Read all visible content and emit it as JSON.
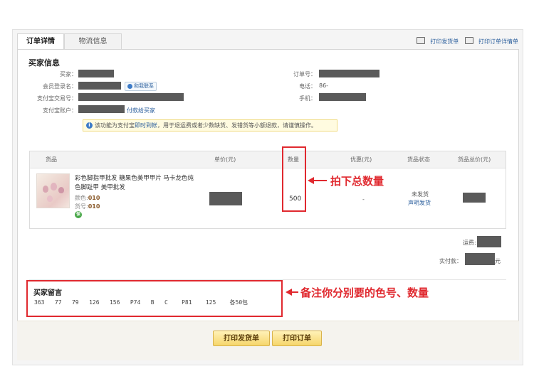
{
  "tabs": [
    {
      "label": "订单详情"
    },
    {
      "label": "物流信息"
    }
  ],
  "print_links": {
    "print_shipping": "打印发货单",
    "print_order": "打印订单详情单"
  },
  "buyer_info": {
    "title": "买家信息",
    "buyer_label": "买家：",
    "login_label": "会员登录名：",
    "contact_button": "和我联系",
    "alipay_trade_label": "支付宝交易号：",
    "alipay_account_label": "支付宝账户：",
    "pay_buyer_link": "付款给买家",
    "order_no_label": "订单号：",
    "phone_label": "电话：",
    "phone_value": "86-",
    "mobile_label": "手机："
  },
  "notice": {
    "icon": "info-icon",
    "prefix": "该功能为支付宝",
    "highlight": "即时到帐",
    "suffix": "，用于退运费或者少数缺货、发错货等小额退款，请谨慎操作。"
  },
  "table": {
    "headers": [
      "货品",
      "单价(元)",
      "数量",
      "优惠(元)",
      "货品状态",
      "货品总价(元)"
    ],
    "row": {
      "title": "彩色脚指甲批发 糖果色美甲甲片 马卡龙色纯色脚趾甲 美甲批发",
      "color_label": "颜色:",
      "color_value": "010",
      "item_no_label": "货号:",
      "item_no_value": "010",
      "quantity": "500",
      "discount": "-",
      "status": "未发货",
      "status_link": "声明发货"
    }
  },
  "summary": {
    "freight_label": "运费:",
    "paid_label": "实付款：",
    "paid_unit": "元"
  },
  "annotations": {
    "quantity_note": "拍下总数量",
    "remark_note": "备注你分别要的色号、数量"
  },
  "buyer_remark": {
    "title": "买家留言",
    "text": "363   77   79   126   156   P74   B   C    P81    125    各50包"
  },
  "buttons": {
    "print_shipping": "打印发货单",
    "print_order": "打印订单"
  },
  "colors": {
    "annotation_red": "#e0292f",
    "link_blue": "#2a5e9c",
    "button_yellow": "#f6d66b"
  }
}
